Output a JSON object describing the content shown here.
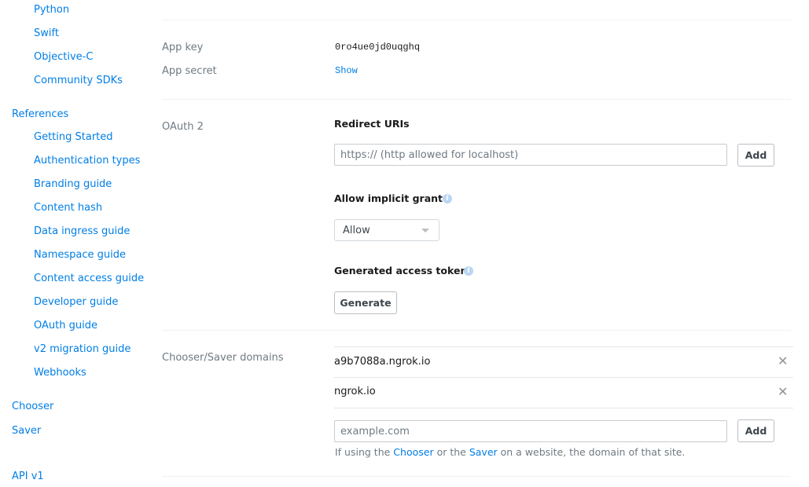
{
  "sidebar": {
    "sdk_items": [
      "Python",
      "Swift",
      "Objective-C",
      "Community SDKs"
    ],
    "references_label": "References",
    "reference_items": [
      "Getting Started",
      "Authentication types",
      "Branding guide",
      "Content hash",
      "Data ingress guide",
      "Namespace guide",
      "Content access guide",
      "Developer guide",
      "OAuth guide",
      "v2 migration guide",
      "Webhooks"
    ],
    "chooser": "Chooser",
    "saver": "Saver",
    "api_v1": "API v1"
  },
  "app": {
    "key_label": "App key",
    "key_value": "0ro4ue0jd0uqghq",
    "secret_label": "App secret",
    "secret_show": "Show"
  },
  "oauth": {
    "label": "OAuth 2",
    "redirect_title": "Redirect URIs",
    "redirect_placeholder": "https:// (http allowed for localhost)",
    "add": "Add",
    "implicit_title": "Allow implicit grant",
    "implicit_value": "Allow",
    "token_title": "Generated access token",
    "generate": "Generate"
  },
  "domains": {
    "label": "Chooser/Saver domains",
    "items": [
      "a9b7088a.ngrok.io",
      "ngrok.io"
    ],
    "placeholder": "example.com",
    "add": "Add",
    "help_prefix": "If using the ",
    "help_chooser": "Chooser",
    "help_mid": " or the ",
    "help_saver": "Saver",
    "help_suffix": " on a website, the domain of that site."
  }
}
